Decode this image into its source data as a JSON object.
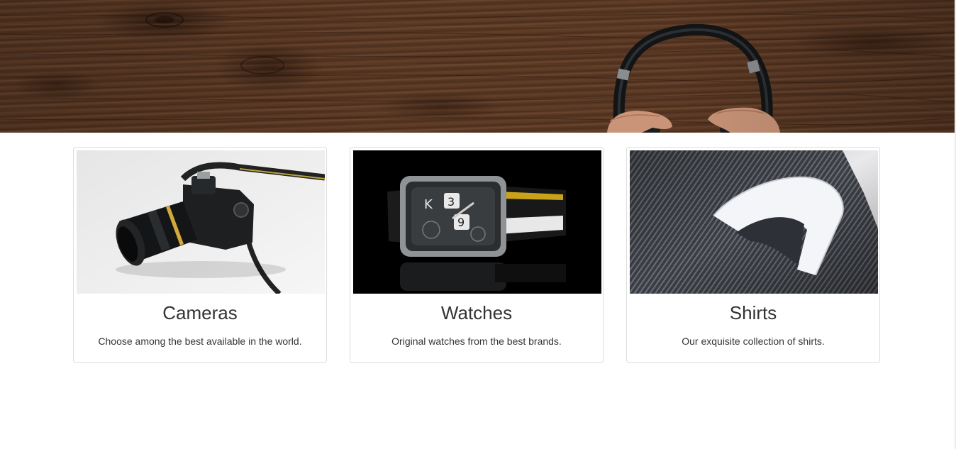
{
  "hero": {
    "image": "headphones-on-wood-banner"
  },
  "categories": [
    {
      "title": "Cameras",
      "description": "Choose among the best available in the world.",
      "image": "dslr-camera-photo"
    },
    {
      "title": "Watches",
      "description": "Original watches from the best brands.",
      "image": "wristwatch-photo"
    },
    {
      "title": "Shirts",
      "description": "Our exquisite collection of shirts.",
      "image": "folded-shirt-photo"
    }
  ],
  "colors": {
    "text": "#333333",
    "card_border": "#dddddd",
    "wood": "#553521"
  }
}
